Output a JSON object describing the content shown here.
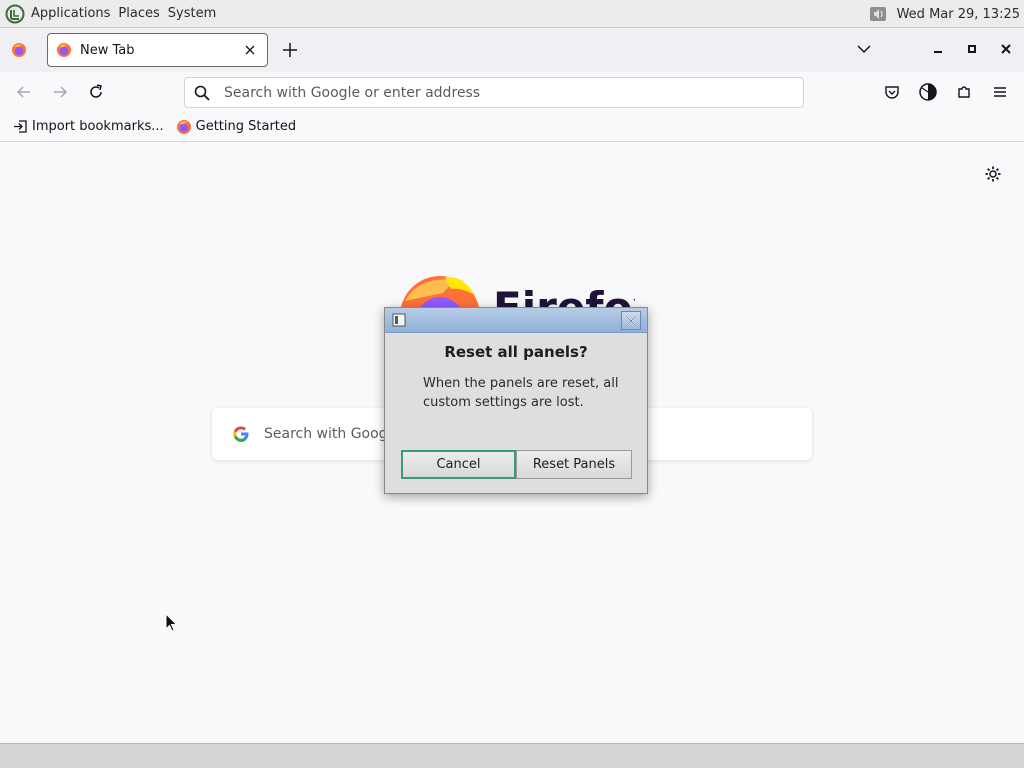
{
  "top_panel": {
    "menus": [
      "Applications",
      "Places",
      "System"
    ],
    "clock": "Wed Mar 29, 13:25",
    "icons": [
      "os-logo-icon",
      "volume-icon"
    ]
  },
  "browser": {
    "tab": {
      "title": "New Tab"
    },
    "urlbar": {
      "placeholder": "Search with Google or enter address"
    },
    "bookmarks": [
      {
        "label": "Import bookmarks...",
        "icon": "import-icon"
      },
      {
        "label": "Getting Started",
        "icon": "firefox-icon"
      }
    ],
    "newtab": {
      "wordmark": "Firefox",
      "search_placeholder": "Search with Google or enter address"
    }
  },
  "dialog": {
    "heading": "Reset all panels?",
    "message": "When the panels are reset, all custom settings are lost.",
    "cancel_label": "Cancel",
    "reset_label": "Reset Panels"
  },
  "colors": {
    "accent_focus": "#3a9a73",
    "titlebar": "#8fb0d6",
    "panel_bg": "#ececec"
  }
}
